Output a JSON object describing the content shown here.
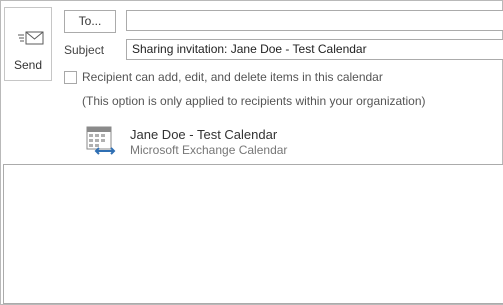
{
  "send": {
    "label": "Send",
    "icon": "envelope-send-icon"
  },
  "to": {
    "button_label": "To...",
    "value": ""
  },
  "subject": {
    "label": "Subject",
    "value": "Sharing invitation:  Jane Doe - Test Calendar"
  },
  "permission": {
    "checked": false,
    "label": "Recipient can add, edit, and delete items in this calendar",
    "note": "(This option is only applied to recipients within your organization)"
  },
  "calendar": {
    "name": "Jane Doe - Test Calendar",
    "type": "Microsoft Exchange Calendar",
    "icon": "shared-calendar-icon"
  },
  "message_body": {
    "value": ""
  },
  "colors": {
    "border": "#ababab",
    "accent": "#2f6fb3"
  }
}
